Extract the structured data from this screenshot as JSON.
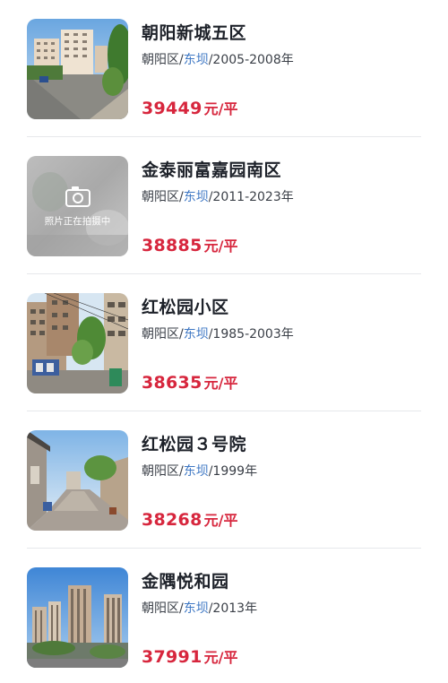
{
  "listings": [
    {
      "name": "朝阳新城五区",
      "district": "朝阳区",
      "separator": "/",
      "subdistrict": "东坝",
      "years": "/2005-2008年",
      "price": "39449",
      "unit": "元/平",
      "photo": "residential-blocks-photo"
    },
    {
      "name": "金泰丽富嘉园南区",
      "district": "朝阳区",
      "separator": "/",
      "subdistrict": "东坝",
      "years": "/2011-2023年",
      "price": "38885",
      "unit": "元/平",
      "photo": "placeholder",
      "photo_text": "照片正在拍摄中"
    },
    {
      "name": "红松园小区",
      "district": "朝阳区",
      "separator": "/",
      "subdistrict": "东坝",
      "years": "/1985-2003年",
      "price": "38635",
      "unit": "元/平",
      "photo": "alley-buildings-photo"
    },
    {
      "name": "红松园３号院",
      "district": "朝阳区",
      "separator": "/",
      "subdistrict": "东坝",
      "years": "/1999年",
      "price": "38268",
      "unit": "元/平",
      "photo": "courtyard-lane-photo"
    },
    {
      "name": "金隅悦和园",
      "district": "朝阳区",
      "separator": "/",
      "subdistrict": "东坝",
      "years": "/2013年",
      "price": "37991",
      "unit": "元/平",
      "photo": "highrise-towers-photo"
    }
  ],
  "colors": {
    "price": "#d7263d",
    "subdistrict_link": "#3f78c4",
    "title": "#1d2129",
    "divider": "#e6e8eb"
  }
}
